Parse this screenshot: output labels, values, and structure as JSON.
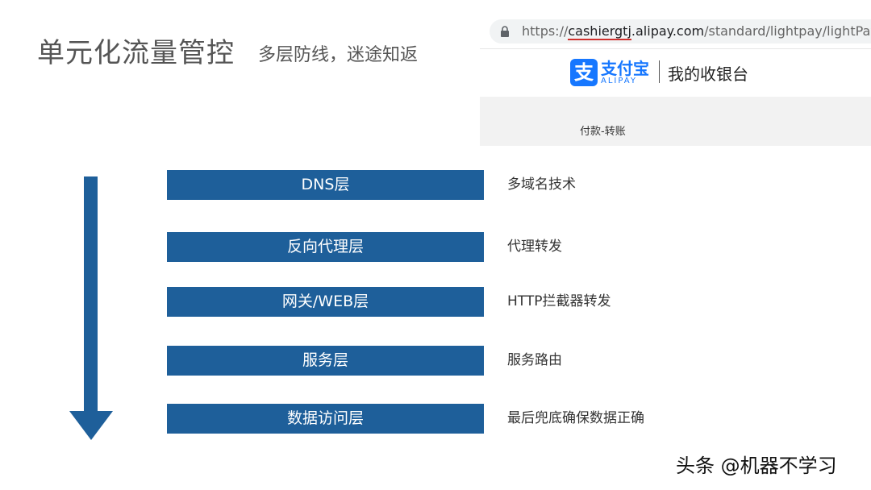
{
  "slide": {
    "title": "单元化流量管控",
    "subtitle": "多层防线，迷途知返"
  },
  "browser": {
    "url_prefix": "https://",
    "url_underlined": "cashiergtj",
    "url_domain": ".alipay.com",
    "url_path": "/standard/lightpay/lightPayCash",
    "brand_name": "支付宝",
    "brand_en": "ALIPAY",
    "brand_icon_glyph": "支",
    "cashier_title": "我的收银台",
    "pay_label": "付款-转账"
  },
  "layers": [
    {
      "label": "DNS层",
      "desc": "多域名技术"
    },
    {
      "label": "反向代理层",
      "desc": "代理转发"
    },
    {
      "label": "网关/WEB层",
      "desc": "HTTP拦截器转发"
    },
    {
      "label": "服务层",
      "desc": "服务路由"
    },
    {
      "label": "数据访问层",
      "desc": "最后兜底确保数据正确"
    }
  ],
  "watermark": "头条 @机器不学习",
  "colors": {
    "layer_bg": "#1e5f9a",
    "alipay_blue": "#1677ff"
  }
}
